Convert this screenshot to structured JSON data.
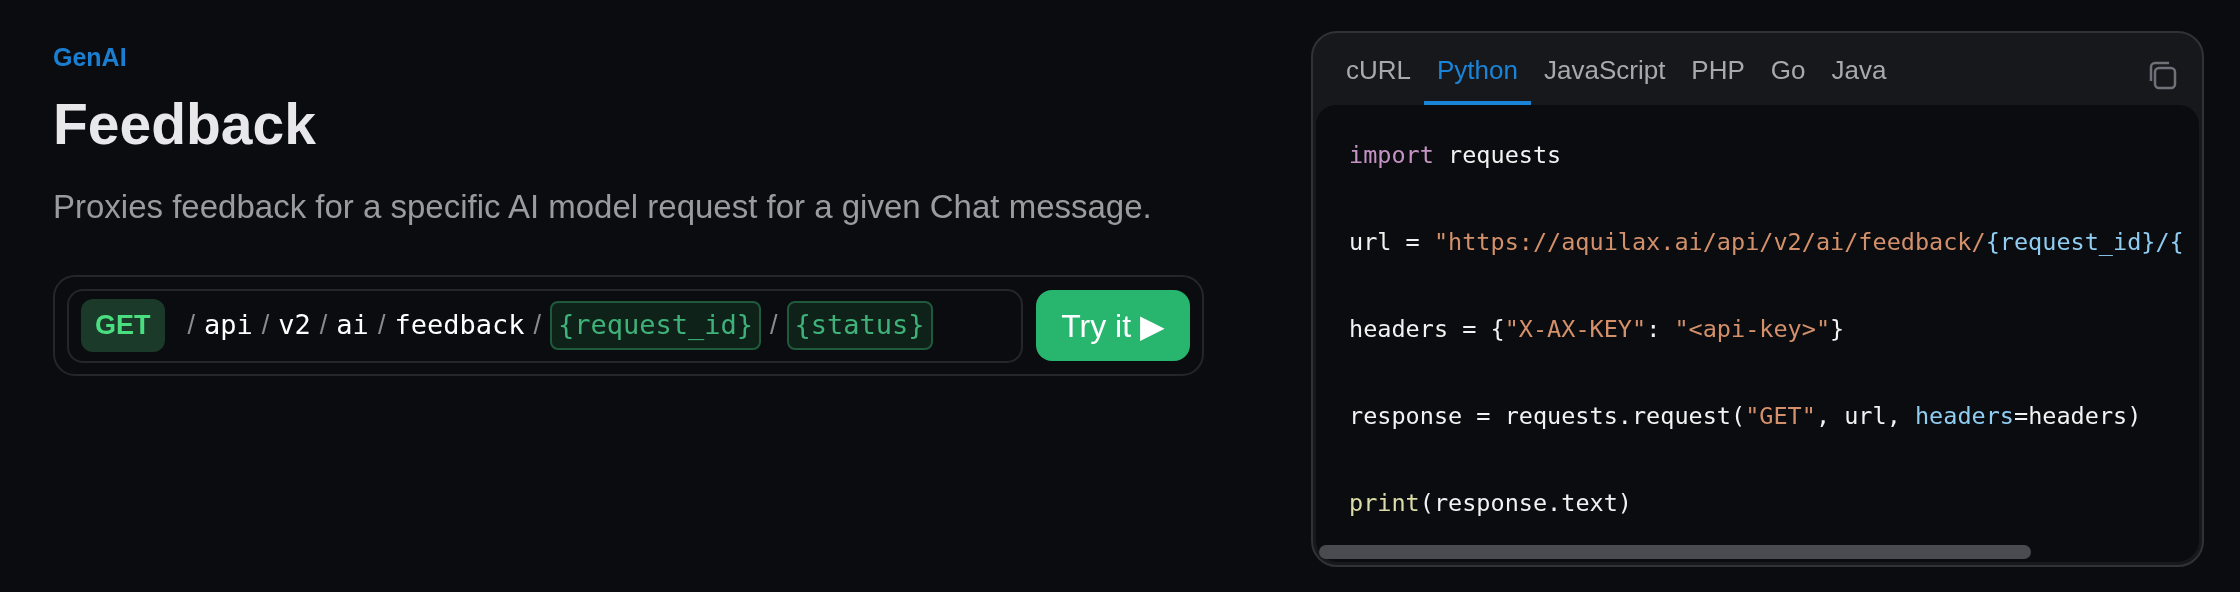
{
  "eyebrow": "GenAI",
  "title": "Feedback",
  "description": "Proxies feedback for a specific AI model request for a given Chat message.",
  "endpoint": {
    "method": "GET",
    "separator": "/",
    "segments": [
      {
        "kind": "static",
        "text": "api"
      },
      {
        "kind": "static",
        "text": "v2"
      },
      {
        "kind": "static",
        "text": "ai"
      },
      {
        "kind": "static",
        "text": "feedback"
      },
      {
        "kind": "param",
        "text": "{request_id}"
      },
      {
        "kind": "param",
        "text": "{status}"
      }
    ],
    "button": "Try it ▶"
  },
  "code_panel": {
    "tabs": [
      {
        "label": "cURL",
        "selected": false
      },
      {
        "label": "Python",
        "selected": true
      },
      {
        "label": "JavaScript",
        "selected": false
      },
      {
        "label": "PHP",
        "selected": false
      },
      {
        "label": "Go",
        "selected": false
      },
      {
        "label": "Java",
        "selected": false
      }
    ],
    "lines": [
      [
        {
          "kind": "keyword",
          "text": "import"
        },
        {
          "kind": "plain",
          "text": " requests"
        }
      ],
      [
        {
          "kind": "plain",
          "text": "url = "
        },
        {
          "kind": "string",
          "text": "\"https://aquilax.ai/api/v2/ai/feedback/"
        },
        {
          "kind": "param",
          "text": "{request_id}/{"
        }
      ],
      [
        {
          "kind": "plain",
          "text": "headers = {"
        },
        {
          "kind": "string",
          "text": "\"X-AX-KEY\""
        },
        {
          "kind": "plain",
          "text": ": "
        },
        {
          "kind": "string",
          "text": "\"<api-key>\""
        },
        {
          "kind": "plain",
          "text": "}"
        }
      ],
      [
        {
          "kind": "plain",
          "text": "response = requests.request("
        },
        {
          "kind": "string",
          "text": "\"GET\""
        },
        {
          "kind": "plain",
          "text": ", url, "
        },
        {
          "kind": "param",
          "text": "headers"
        },
        {
          "kind": "plain",
          "text": "=headers)"
        }
      ],
      [
        {
          "kind": "function",
          "text": "print"
        },
        {
          "kind": "plain",
          "text": "(response.text)"
        }
      ]
    ]
  }
}
